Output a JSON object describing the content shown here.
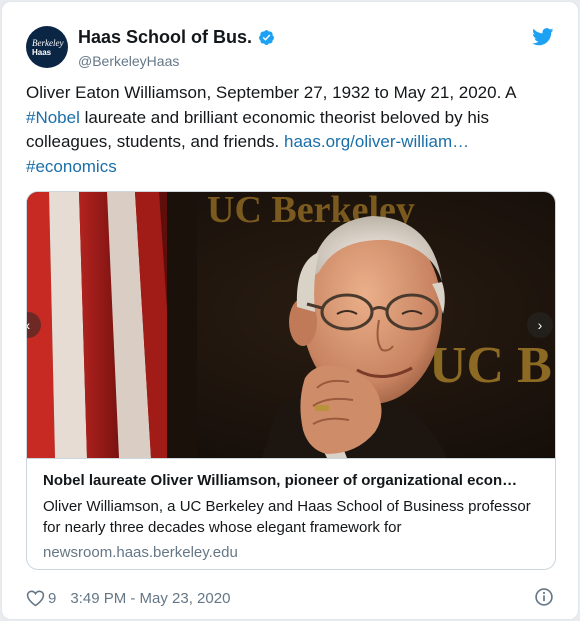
{
  "account": {
    "avatar_line1": "Berkeley",
    "avatar_line2": "Haas",
    "display_name": "Haas School of Bus.",
    "handle": "@BerkeleyHaas",
    "verified": true
  },
  "tweet": {
    "text_part1": "Oliver Eaton Williamson, September 27, 1932 to May 21, 2020. A ",
    "hashtag1": "#Nobel",
    "text_part2": " laureate and brilliant economic theorist beloved by his colleagues, students, and friends. ",
    "url": "haas.org/oliver-william…",
    "hashtag2": "#economics"
  },
  "card": {
    "image_sign_top": "UC Berkeley",
    "image_sign_right": "UC B",
    "title": "Nobel laureate Oliver Williamson, pioneer of organizational econ…",
    "description": "Oliver Williamson, a UC Berkeley and Haas School of Business professor for nearly three decades whose elegant framework for",
    "domain": "newsroom.haas.berkeley.edu"
  },
  "footer": {
    "likes": "9",
    "timestamp": "3:49 PM - May 23, 2020"
  },
  "colors": {
    "link": "#1b6fa8",
    "verified": "#1da1f2",
    "twitter_blue": "#1da1f2",
    "secondary_text": "#657786"
  },
  "icons": [
    "verified-badge-icon",
    "twitter-bird-icon",
    "heart-icon",
    "info-icon",
    "chevron-right-icon",
    "chevron-left-icon"
  ]
}
